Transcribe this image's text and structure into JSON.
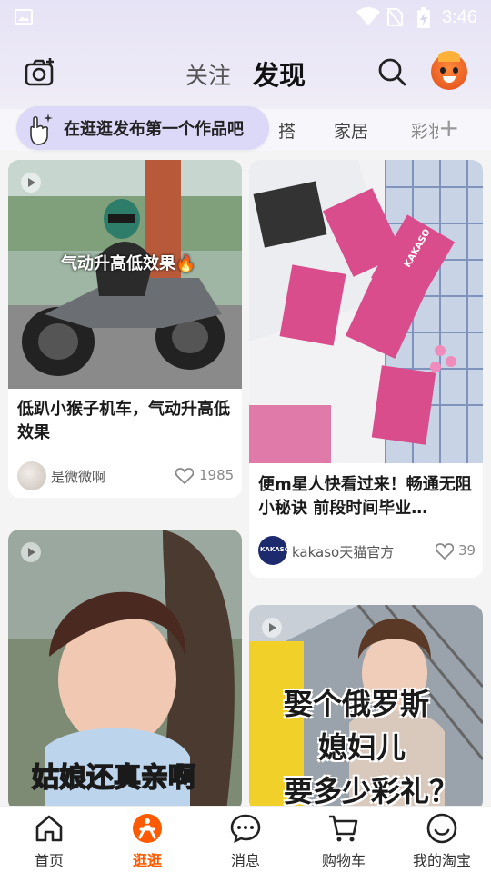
{
  "status_bar": {
    "time": "3:46"
  },
  "header": {
    "tab_follow": "关注",
    "tab_discover": "发现",
    "camera_icon": "camera-plus-icon",
    "search_icon": "search-icon"
  },
  "categories": {
    "partial_left": "搭",
    "home": "家居",
    "partial_right": "彩妆",
    "plus": "+"
  },
  "publish_tip": {
    "text": "在逛逛发布第一个作品吧"
  },
  "feed": [
    {
      "overlay": "气动升高低效果🔥",
      "title": "低趴小猴子机车，气动升高低效果",
      "author": "是微微啊",
      "likes": "1985"
    },
    {
      "title": "便m星人快看过来！畅通无阻小秘诀  前段时间毕业…",
      "author": "kakaso天猫官方",
      "author_badge": "KAKASO",
      "product_label": "KAKASO",
      "likes": "39"
    },
    {
      "overlay": "姑娘还真亲啊"
    },
    {
      "overlay_line1": "娶个俄罗斯",
      "overlay_line2": "媳妇儿",
      "overlay_line3": "要多少彩礼？"
    }
  ],
  "bottom_nav": [
    {
      "label": "首页",
      "icon": "home-icon"
    },
    {
      "label": "逛逛",
      "icon": "guangguang-icon",
      "active": true
    },
    {
      "label": "消息",
      "icon": "message-icon"
    },
    {
      "label": "购物车",
      "icon": "cart-icon"
    },
    {
      "label": "我的淘宝",
      "icon": "profile-icon"
    }
  ],
  "colors": {
    "accent": "#ff5a00",
    "tip_bg": "#dcd8f8",
    "pink_pack": "#d94d8c"
  }
}
